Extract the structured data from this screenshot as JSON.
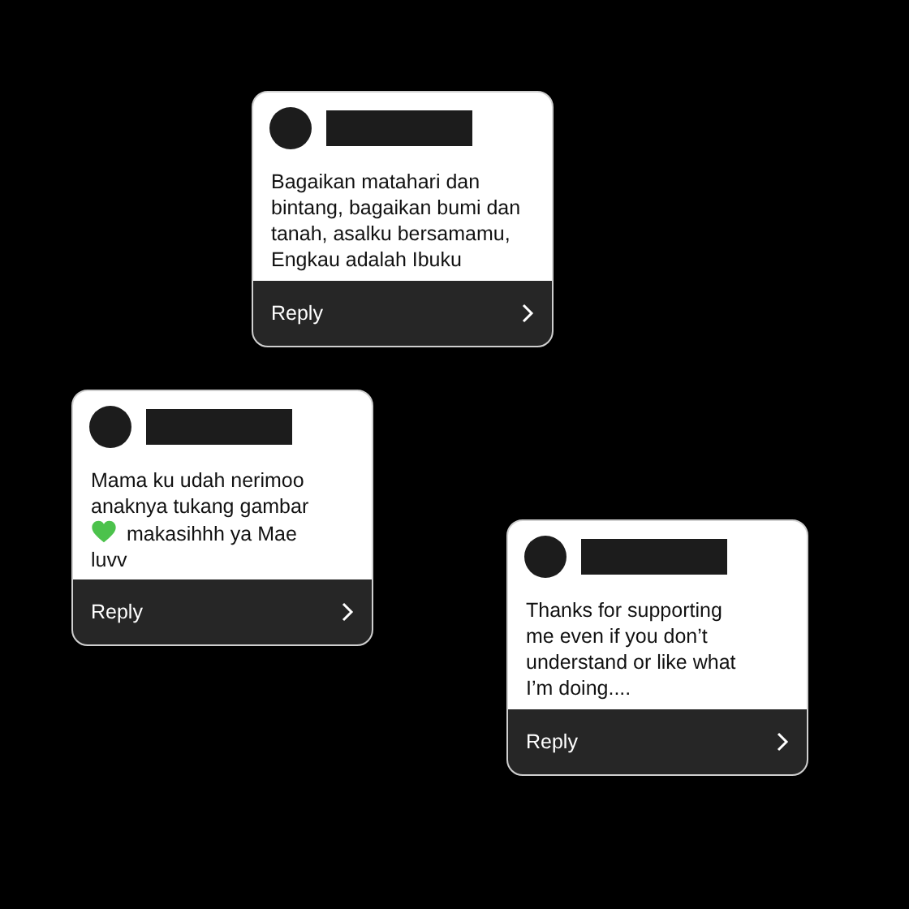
{
  "cards": [
    {
      "message": [
        {
          "text": "Bagaikan matahari dan"
        },
        {
          "text": "bintang, bagaikan bumi dan"
        },
        {
          "text": "tanah, asalku bersamamu,"
        },
        {
          "text": "Engkau adalah Ibuku"
        }
      ],
      "reply": "Reply"
    },
    {
      "message": [
        {
          "text": "Mama ku udah nerimoo"
        },
        {
          "text": "anaknya tukang gambar"
        },
        {
          "kind": "heart",
          "text": "makasihhh ya Mae"
        },
        {
          "text": "luvv"
        }
      ],
      "reply": "Reply"
    },
    {
      "message": [
        {
          "text": "Thanks for supporting"
        },
        {
          "text": "me even if you don’t"
        },
        {
          "text": "understand or like what"
        },
        {
          "text": "I’m doing...."
        }
      ],
      "reply": "Reply"
    }
  ]
}
